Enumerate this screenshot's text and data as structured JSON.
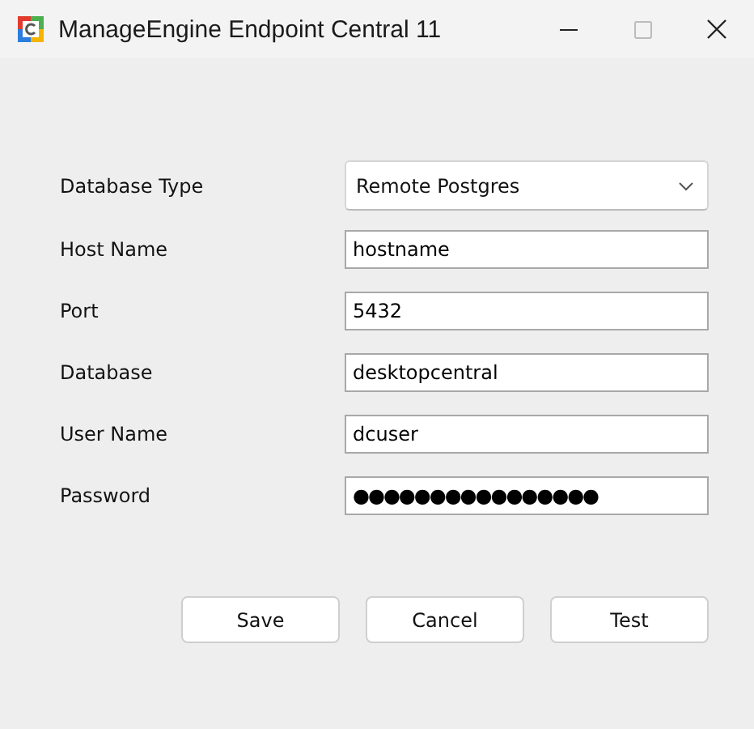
{
  "window": {
    "title": "ManageEngine Endpoint Central 11"
  },
  "fields": [
    {
      "kind": "dropdown",
      "label": "Database Type",
      "value": "Remote Postgres"
    },
    {
      "kind": "text",
      "label": "Host Name",
      "value": "hostname"
    },
    {
      "kind": "text",
      "label": "Port",
      "value": "5432"
    },
    {
      "kind": "text",
      "label": "Database",
      "value": "desktopcentral"
    },
    {
      "kind": "text",
      "label": "User Name",
      "value": "dcuser"
    },
    {
      "kind": "password",
      "label": "Password",
      "value": "●●●●●●●●●●●●●●●●"
    }
  ],
  "buttons": [
    "Save",
    "Cancel",
    "Test"
  ]
}
